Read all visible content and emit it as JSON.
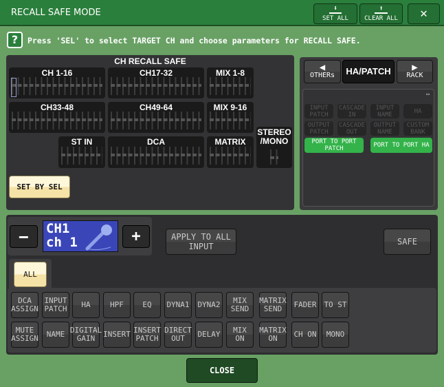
{
  "window": {
    "title": "RECALL SAFE MODE",
    "set_all": "SET ALL",
    "clear_all": "CLEAR ALL",
    "close_icon": "close-x"
  },
  "help": {
    "icon": "?",
    "text": "Press 'SEL' to select TARGET CH and choose parameters for RECALL SAFE."
  },
  "ch_recall_safe": {
    "title": "CH RECALL SAFE",
    "groups": [
      "CH 1-16",
      "CH17-32",
      "MIX 1-8",
      "CH33-48",
      "CH49-64",
      "MIX 9-16",
      "ST IN",
      "DCA",
      "MATRIX",
      "STEREO /MONO"
    ],
    "set_by_sel": "SET BY SEL"
  },
  "ha_patch": {
    "prev_label": "OTHERs",
    "current": "HA/PATCH",
    "next_label": "RACK",
    "buttons": [
      "INPUT PATCH",
      "CASCADE IN",
      "INPUT NAME",
      "HA",
      "OUTPUT PATCH",
      "CASCADE OUT",
      "OUTPUT NAME",
      "CUSTOM BANK"
    ],
    "active_buttons": [
      "PORT TO PORT PATCH",
      "PORT TO PORT HA"
    ],
    "accent": "#33b34a"
  },
  "channel": {
    "minus": "−",
    "plus": "+",
    "id": "CH1",
    "name": "ch 1",
    "icon": "microphone-icon",
    "color": "#3a46b8"
  },
  "apply_all_input": "APPLY TO ALL INPUT",
  "safe": "SAFE",
  "all": "ALL",
  "params": [
    [
      "DCA ASSIGN",
      "INPUT PATCH",
      "HA",
      "HPF",
      "EQ",
      "DYNA1",
      "DYNA2",
      "MIX SEND",
      "MATRIX SEND",
      "FADER",
      "TO ST"
    ],
    [
      "MUTE ASSIGN",
      "NAME",
      "DIGITAL GAIN",
      "INSERT",
      "INSERT PATCH",
      "DIRECT OUT",
      "DELAY",
      "MIX ON",
      "MATRIX ON",
      "CH ON",
      "MONO"
    ]
  ],
  "close": "CLOSE"
}
